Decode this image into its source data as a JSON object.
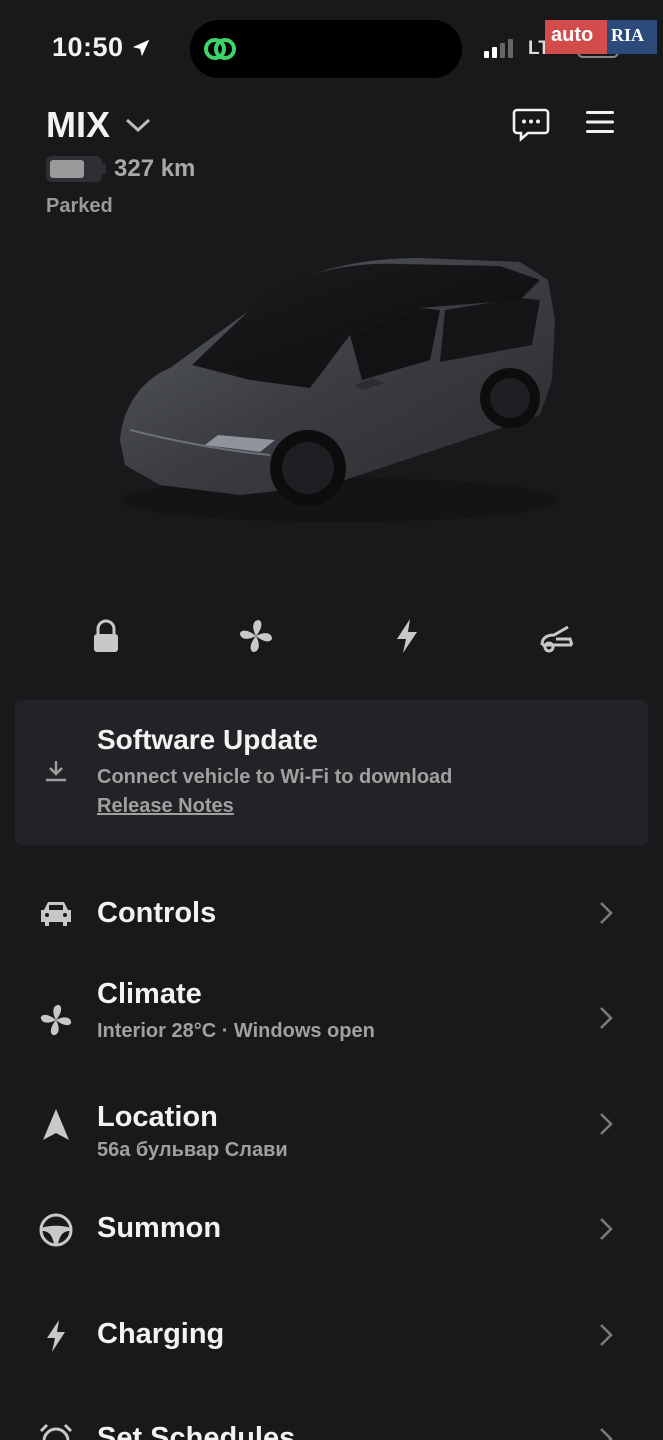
{
  "status_bar": {
    "time": "10:50",
    "network": "LTE",
    "watermark_left": "auto",
    "watermark_right": "RIA"
  },
  "header": {
    "vehicle_name": "MIX",
    "range": "327 km",
    "battery_level": 0.7,
    "state": "Parked",
    "icons": [
      "location-arrow-icon",
      "chevron-down-icon",
      "message-icon",
      "menu-icon"
    ]
  },
  "quick_controls": [
    {
      "name": "lock",
      "icon": "lock-icon"
    },
    {
      "name": "climate",
      "icon": "fan-icon"
    },
    {
      "name": "charge",
      "icon": "bolt-icon"
    },
    {
      "name": "frunk",
      "icon": "frunk-icon"
    }
  ],
  "software_update": {
    "title": "Software Update",
    "subtitle": "Connect vehicle to Wi-Fi to download",
    "link": "Release Notes",
    "icon": "download-icon"
  },
  "menu": [
    {
      "label": "Controls",
      "sub": "",
      "icon": "car-icon"
    },
    {
      "label": "Climate",
      "sub": "Interior 28°C · Windows open",
      "icon": "fan-icon"
    },
    {
      "label": "Location",
      "sub": "56а бульвар Слави",
      "icon": "navigation-icon"
    },
    {
      "label": "Summon",
      "sub": "",
      "icon": "steering-wheel-icon"
    },
    {
      "label": "Charging",
      "sub": "",
      "icon": "bolt-icon"
    },
    {
      "label": "Set Schedules",
      "sub": "",
      "icon": "alarm-clock-icon"
    }
  ],
  "colors": {
    "background": "#18191b",
    "card": "#222326",
    "text": "#f2f2f2",
    "muted": "#a0a0a0"
  }
}
